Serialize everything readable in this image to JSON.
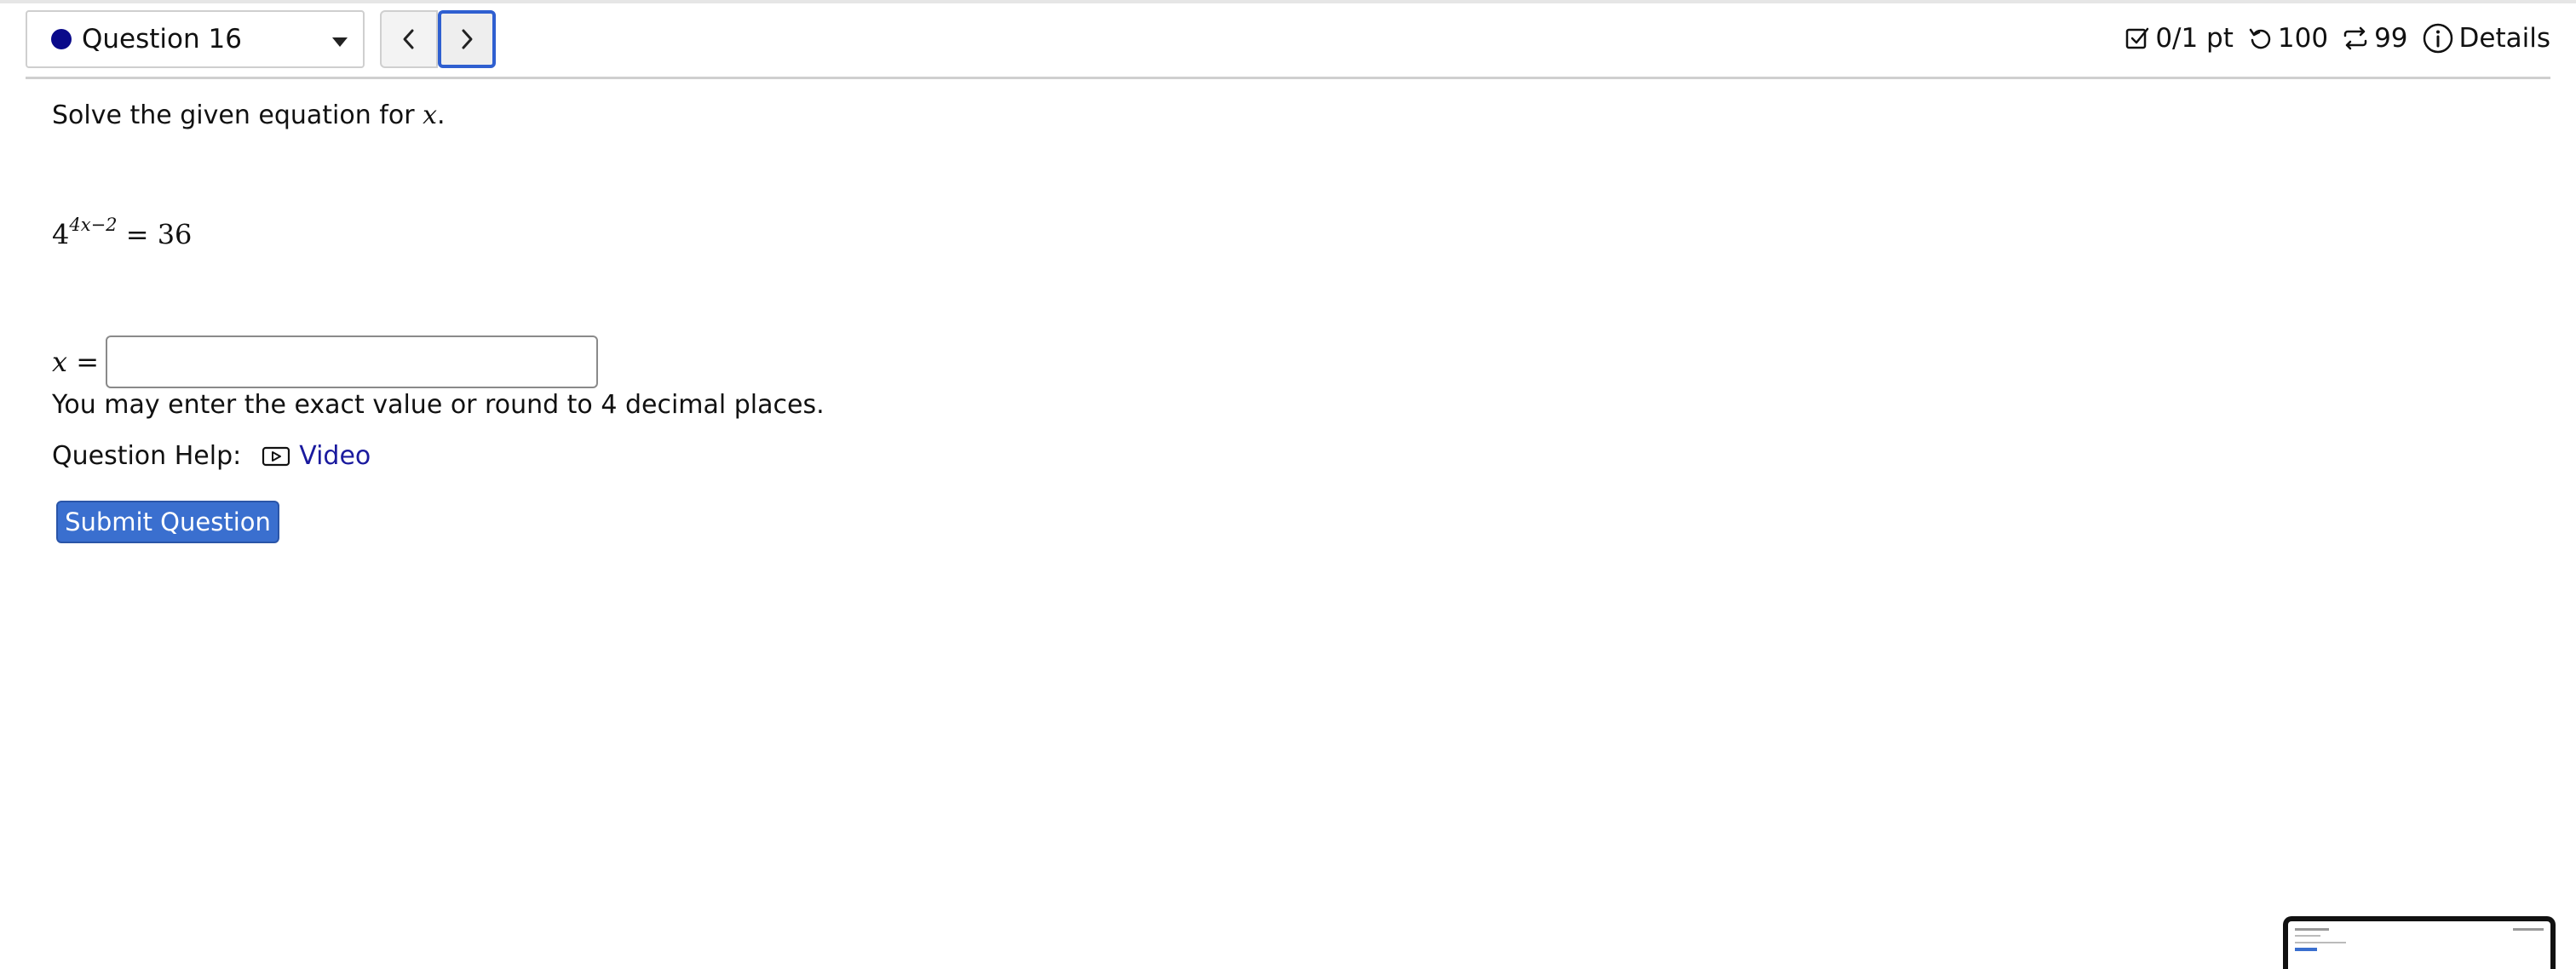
{
  "header": {
    "question_label": "Question 16",
    "score": "0/1 pt",
    "attempts": "100",
    "retries": "99",
    "details_label": "Details"
  },
  "question": {
    "prompt_prefix": "Solve the given equation for ",
    "prompt_var": "x",
    "prompt_suffix": ".",
    "equation_base": "4",
    "equation_exponent": "4x−2",
    "equation_rhs": "= 36",
    "answer_label": "x =",
    "answer_value": "",
    "hint": "You may enter the exact value or round to 4 decimal places.",
    "help_label": "Question Help:",
    "video_label": "Video",
    "submit_label": "Submit Question"
  },
  "colors": {
    "accent": "#3a6fcf",
    "status_dot": "#0a0a8a",
    "link": "#1a1a9e"
  }
}
